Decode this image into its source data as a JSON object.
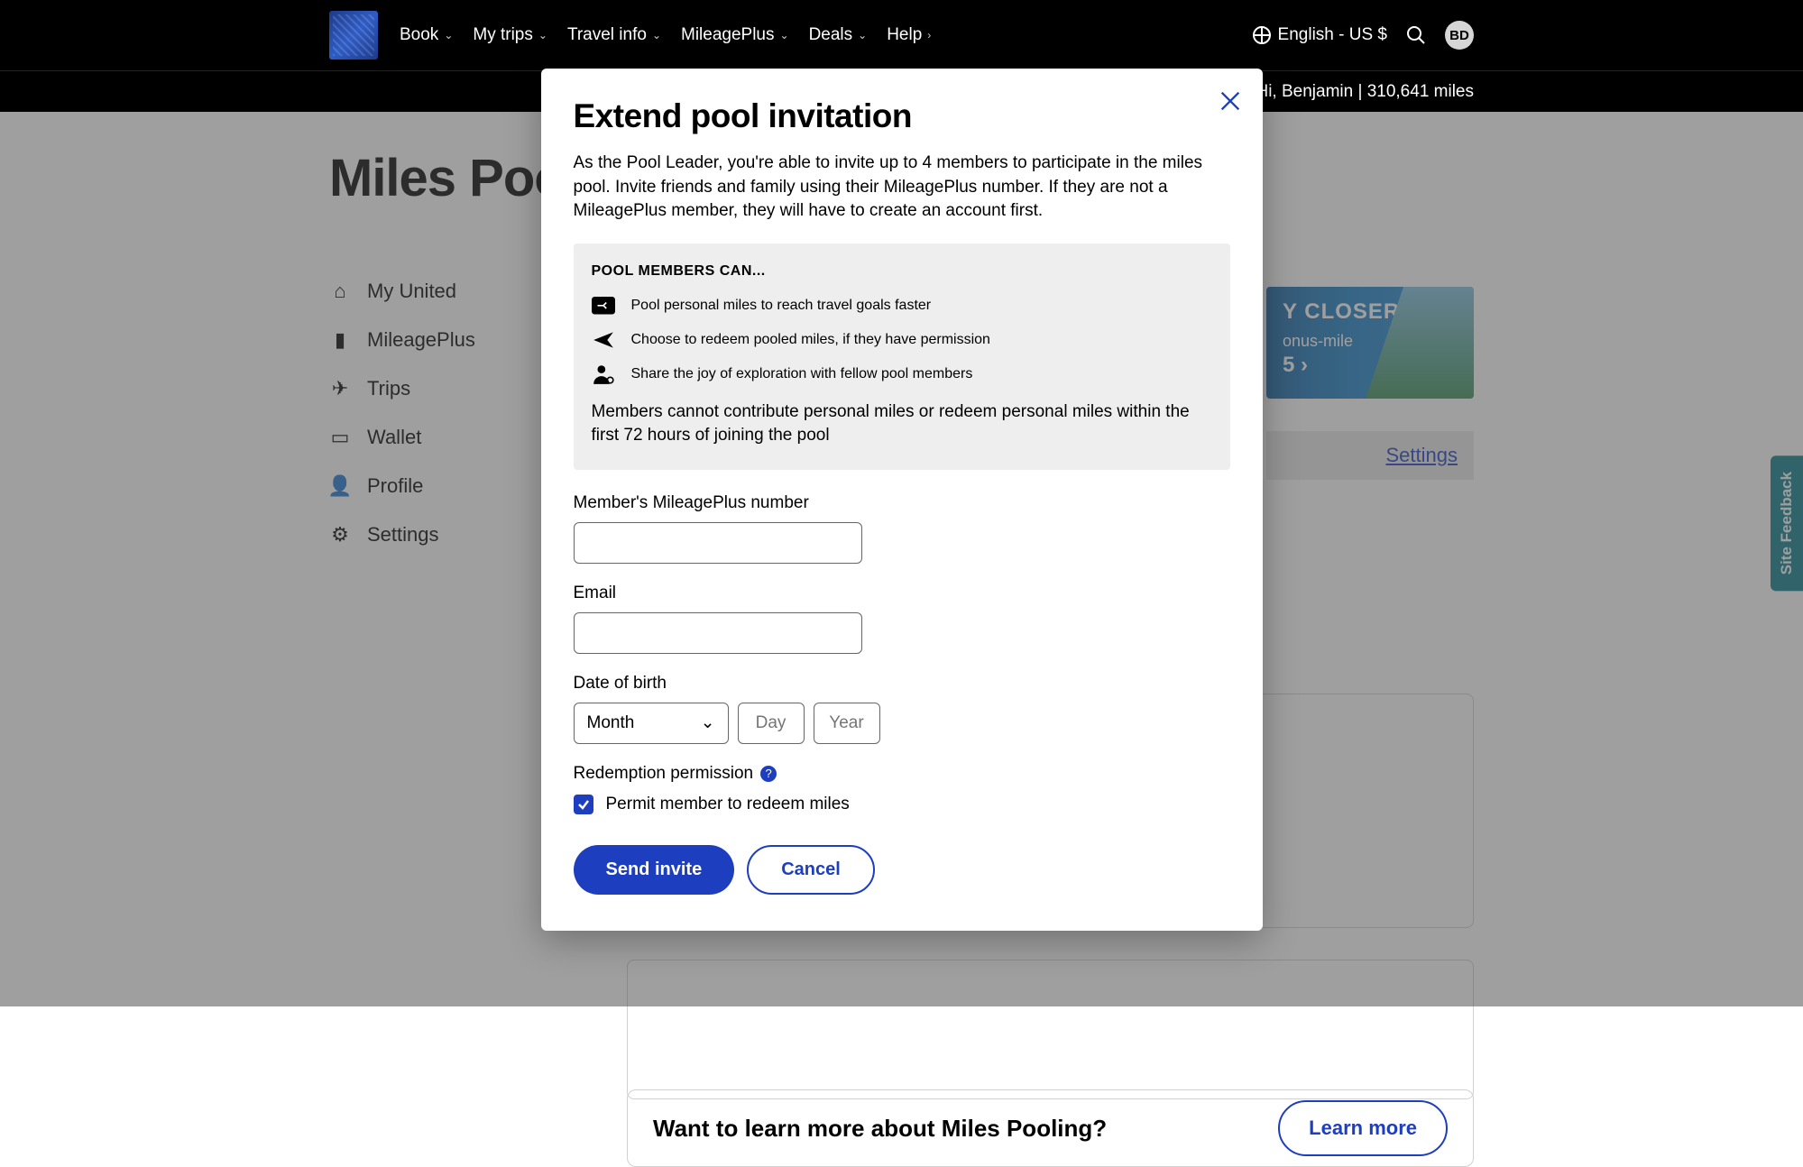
{
  "nav": {
    "items": [
      "Book",
      "My trips",
      "Travel info",
      "MileagePlus",
      "Deals",
      "Help"
    ],
    "language": "English - US $",
    "avatar_initials": "BD"
  },
  "subbar": {
    "greeting": "Hi, Benjamin",
    "miles": "310,641 miles"
  },
  "page": {
    "title": "Miles Poolin"
  },
  "sidebar": {
    "items": [
      {
        "icon": "home-icon",
        "label": "My United"
      },
      {
        "icon": "bookmark-icon",
        "label": "MileagePlus"
      },
      {
        "icon": "plane-icon",
        "label": "Trips"
      },
      {
        "icon": "wallet-icon",
        "label": "Wallet"
      },
      {
        "icon": "person-icon",
        "label": "Profile"
      },
      {
        "icon": "gear-icon",
        "label": "Settings"
      }
    ]
  },
  "promo": {
    "line1": "Y CLOSER",
    "line2": "onus-mile",
    "line3": "5 ›"
  },
  "settings_link": "Settings",
  "learn": {
    "question": "Want to learn more about Miles Pooling?",
    "button": "Learn more"
  },
  "feedback": "Site Feedback",
  "modal": {
    "title": "Extend pool invitation",
    "description": "As the Pool Leader, you're able to invite up to 4 members to participate in the miles pool. Invite friends and family using their MileagePlus number. If they are not a MileagePlus member, they will have to create an account first.",
    "info_heading": "POOL MEMBERS CAN...",
    "bullets": [
      "Pool personal miles to reach travel goals faster",
      "Choose to redeem pooled miles, if they have permission",
      "Share the joy of exploration with fellow pool members"
    ],
    "info_note": "Members cannot contribute personal miles or redeem personal miles within the first 72 hours of joining the pool",
    "fields": {
      "mp_label": "Member's MileagePlus number",
      "email_label": "Email",
      "dob_label": "Date of birth",
      "month_placeholder": "Month",
      "day_placeholder": "Day",
      "year_placeholder": "Year"
    },
    "redemption": {
      "label": "Redemption permission",
      "checkbox": "Permit member to redeem miles"
    },
    "buttons": {
      "send": "Send invite",
      "cancel": "Cancel"
    }
  }
}
